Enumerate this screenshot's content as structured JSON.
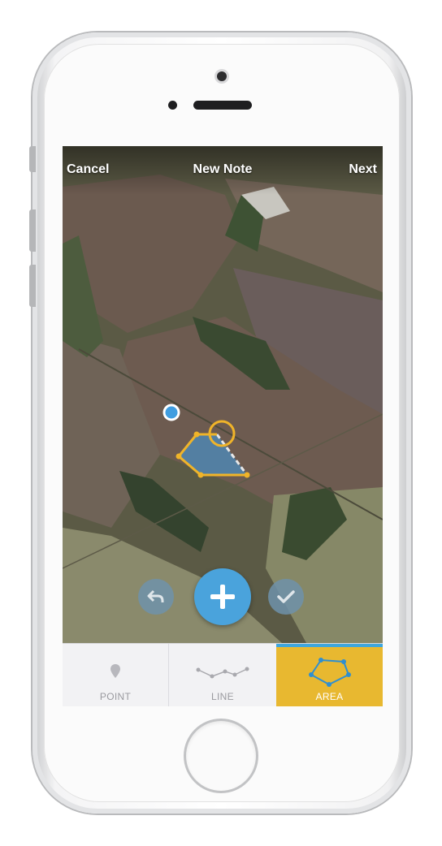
{
  "nav": {
    "cancel": "Cancel",
    "title": "New Note",
    "next": "Next"
  },
  "tabs": [
    {
      "label": "POINT",
      "icon": "pin-icon",
      "selected": false
    },
    {
      "label": "LINE",
      "icon": "polyline-icon",
      "selected": false
    },
    {
      "label": "AREA",
      "icon": "polygon-icon",
      "selected": true
    }
  ],
  "actions": {
    "undo_icon": "undo-icon",
    "add_icon": "plus-icon",
    "confirm_icon": "check-icon"
  },
  "colors": {
    "accent_blue": "#4aa3dc",
    "area_yellow": "#e8b830",
    "polygon_fill": "#4f86b0",
    "polygon_stroke": "#f0b429"
  }
}
